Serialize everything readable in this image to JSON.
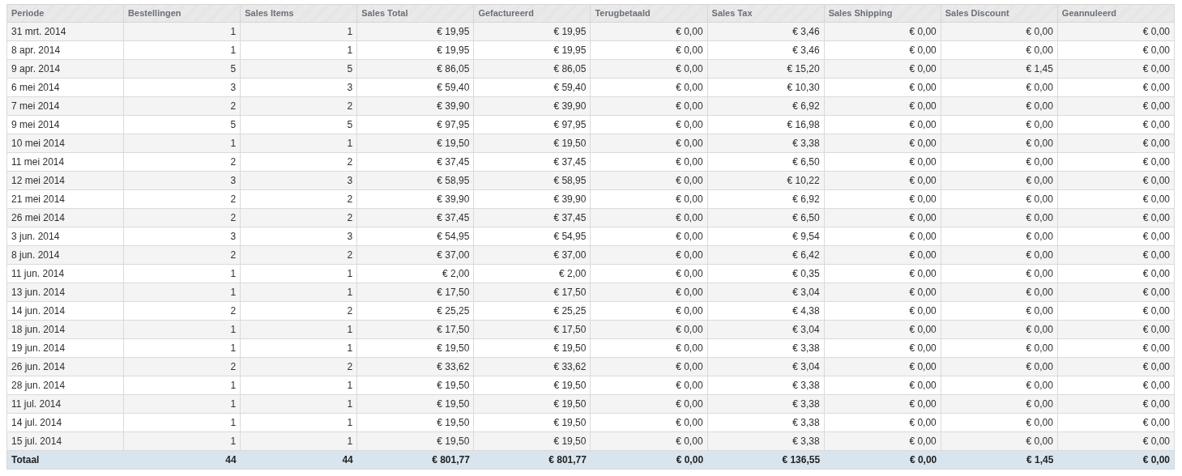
{
  "table": {
    "columns": [
      "Periode",
      "Bestellingen",
      "Sales Items",
      "Sales Total",
      "Gefactureerd",
      "Terugbetaald",
      "Sales Tax",
      "Sales Shipping",
      "Sales Discount",
      "Geannuleerd"
    ],
    "rows": [
      [
        "31 mrt. 2014",
        "1",
        "1",
        "€ 19,95",
        "€ 19,95",
        "€ 0,00",
        "€ 3,46",
        "€ 0,00",
        "€ 0,00",
        "€ 0,00"
      ],
      [
        "8 apr. 2014",
        "1",
        "1",
        "€ 19,95",
        "€ 19,95",
        "€ 0,00",
        "€ 3,46",
        "€ 0,00",
        "€ 0,00",
        "€ 0,00"
      ],
      [
        "9 apr. 2014",
        "5",
        "5",
        "€ 86,05",
        "€ 86,05",
        "€ 0,00",
        "€ 15,20",
        "€ 0,00",
        "€ 1,45",
        "€ 0,00"
      ],
      [
        "6 mei 2014",
        "3",
        "3",
        "€ 59,40",
        "€ 59,40",
        "€ 0,00",
        "€ 10,30",
        "€ 0,00",
        "€ 0,00",
        "€ 0,00"
      ],
      [
        "7 mei 2014",
        "2",
        "2",
        "€ 39,90",
        "€ 39,90",
        "€ 0,00",
        "€ 6,92",
        "€ 0,00",
        "€ 0,00",
        "€ 0,00"
      ],
      [
        "9 mei 2014",
        "5",
        "5",
        "€ 97,95",
        "€ 97,95",
        "€ 0,00",
        "€ 16,98",
        "€ 0,00",
        "€ 0,00",
        "€ 0,00"
      ],
      [
        "10 mei 2014",
        "1",
        "1",
        "€ 19,50",
        "€ 19,50",
        "€ 0,00",
        "€ 3,38",
        "€ 0,00",
        "€ 0,00",
        "€ 0,00"
      ],
      [
        "11 mei 2014",
        "2",
        "2",
        "€ 37,45",
        "€ 37,45",
        "€ 0,00",
        "€ 6,50",
        "€ 0,00",
        "€ 0,00",
        "€ 0,00"
      ],
      [
        "12 mei 2014",
        "3",
        "3",
        "€ 58,95",
        "€ 58,95",
        "€ 0,00",
        "€ 10,22",
        "€ 0,00",
        "€ 0,00",
        "€ 0,00"
      ],
      [
        "21 mei 2014",
        "2",
        "2",
        "€ 39,90",
        "€ 39,90",
        "€ 0,00",
        "€ 6,92",
        "€ 0,00",
        "€ 0,00",
        "€ 0,00"
      ],
      [
        "26 mei 2014",
        "2",
        "2",
        "€ 37,45",
        "€ 37,45",
        "€ 0,00",
        "€ 6,50",
        "€ 0,00",
        "€ 0,00",
        "€ 0,00"
      ],
      [
        "3 jun. 2014",
        "3",
        "3",
        "€ 54,95",
        "€ 54,95",
        "€ 0,00",
        "€ 9,54",
        "€ 0,00",
        "€ 0,00",
        "€ 0,00"
      ],
      [
        "8 jun. 2014",
        "2",
        "2",
        "€ 37,00",
        "€ 37,00",
        "€ 0,00",
        "€ 6,42",
        "€ 0,00",
        "€ 0,00",
        "€ 0,00"
      ],
      [
        "11 jun. 2014",
        "1",
        "1",
        "€ 2,00",
        "€ 2,00",
        "€ 0,00",
        "€ 0,35",
        "€ 0,00",
        "€ 0,00",
        "€ 0,00"
      ],
      [
        "13 jun. 2014",
        "1",
        "1",
        "€ 17,50",
        "€ 17,50",
        "€ 0,00",
        "€ 3,04",
        "€ 0,00",
        "€ 0,00",
        "€ 0,00"
      ],
      [
        "14 jun. 2014",
        "2",
        "2",
        "€ 25,25",
        "€ 25,25",
        "€ 0,00",
        "€ 4,38",
        "€ 0,00",
        "€ 0,00",
        "€ 0,00"
      ],
      [
        "18 jun. 2014",
        "1",
        "1",
        "€ 17,50",
        "€ 17,50",
        "€ 0,00",
        "€ 3,04",
        "€ 0,00",
        "€ 0,00",
        "€ 0,00"
      ],
      [
        "19 jun. 2014",
        "1",
        "1",
        "€ 19,50",
        "€ 19,50",
        "€ 0,00",
        "€ 3,38",
        "€ 0,00",
        "€ 0,00",
        "€ 0,00"
      ],
      [
        "26 jun. 2014",
        "2",
        "2",
        "€ 33,62",
        "€ 33,62",
        "€ 0,00",
        "€ 3,04",
        "€ 0,00",
        "€ 0,00",
        "€ 0,00"
      ],
      [
        "28 jun. 2014",
        "1",
        "1",
        "€ 19,50",
        "€ 19,50",
        "€ 0,00",
        "€ 3,38",
        "€ 0,00",
        "€ 0,00",
        "€ 0,00"
      ],
      [
        "11 jul. 2014",
        "1",
        "1",
        "€ 19,50",
        "€ 19,50",
        "€ 0,00",
        "€ 3,38",
        "€ 0,00",
        "€ 0,00",
        "€ 0,00"
      ],
      [
        "14 jul. 2014",
        "1",
        "1",
        "€ 19,50",
        "€ 19,50",
        "€ 0,00",
        "€ 3,38",
        "€ 0,00",
        "€ 0,00",
        "€ 0,00"
      ],
      [
        "15 jul. 2014",
        "1",
        "1",
        "€ 19,50",
        "€ 19,50",
        "€ 0,00",
        "€ 3,38",
        "€ 0,00",
        "€ 0,00",
        "€ 0,00"
      ]
    ],
    "totals": [
      "Totaal",
      "44",
      "44",
      "€ 801,77",
      "€ 801,77",
      "€ 0,00",
      "€ 136,55",
      "€ 0,00",
      "€ 1,45",
      "€ 0,00"
    ]
  }
}
